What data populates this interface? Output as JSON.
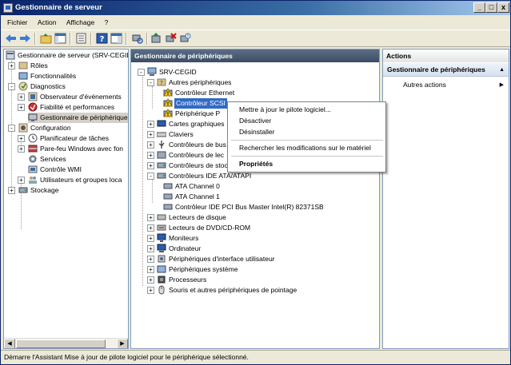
{
  "window": {
    "title": "Gestionnaire de serveur",
    "btn_min": "_",
    "btn_max": "□",
    "btn_close": "x"
  },
  "menu": {
    "items": [
      "Fichier",
      "Action",
      "Affichage",
      "?"
    ]
  },
  "left_tree": {
    "root": "Gestionnaire de serveur (SRV-CEGID",
    "roles": "Rôles",
    "features": "Fonctionnalités",
    "diagnostics": "Diagnostics",
    "event_viewer": "Observateur d'événements",
    "reliability": "Fiabilité et performances",
    "device_manager": "Gestionnaire de périphériques",
    "configuration": "Configuration",
    "task_scheduler": "Planificateur de tâches",
    "firewall": "Pare-feu Windows avec fon",
    "services": "Services",
    "wmi": "Contrôle WMI",
    "users": "Utilisateurs et groupes loca",
    "storage": "Stockage"
  },
  "center": {
    "header": "Gestionnaire de périphériques",
    "computer": "SRV-CEGID",
    "other_devices": "Autres périphériques",
    "eth_ctrl": "Contrôleur Ethernet",
    "scsi_ctrl": "Contrôleur SCSI",
    "other_pp": "Périphérique P",
    "graphics": "Cartes graphiques",
    "keyboards": "Claviers",
    "bus_ctrl": "Contrôleurs de bus",
    "read_ctrl": "Contrôleurs de lec",
    "storage_ctrl": "Contrôleurs de stoc",
    "ide_ctrl": "Contrôleurs IDE ATA/ATAPI",
    "ata0": "ATA Channel 0",
    "ata1": "ATA Channel 1",
    "ide_pci": "Contrôleur IDE PCI Bus Master Intel(R) 82371SB",
    "disk_drives": "Lecteurs de disque",
    "dvd_drives": "Lecteurs de DVD/CD-ROM",
    "monitors": "Moniteurs",
    "computer_node": "Ordinateur",
    "hid": "Périphériques d'interface utilisateur",
    "system": "Périphériques système",
    "processors": "Processeurs",
    "mice": "Souris et autres périphériques de pointage"
  },
  "context_menu": {
    "update": "Mettre à jour le pilote logiciel...",
    "disable": "Désactiver",
    "uninstall": "Désinstaller",
    "scan": "Rechercher les modifications sur le matériel",
    "properties": "Propriétés"
  },
  "actions": {
    "header": "Actions",
    "section": "Gestionnaire de périphériques",
    "more": "Autres actions"
  },
  "status": {
    "text": "Démarre l'Assistant Mise à jour de pilote logiciel pour le périphérique sélectionné."
  },
  "colors": {
    "title_blue": "#0a246a",
    "selection": "#316ac5",
    "pane_header": "#4a5b73"
  }
}
